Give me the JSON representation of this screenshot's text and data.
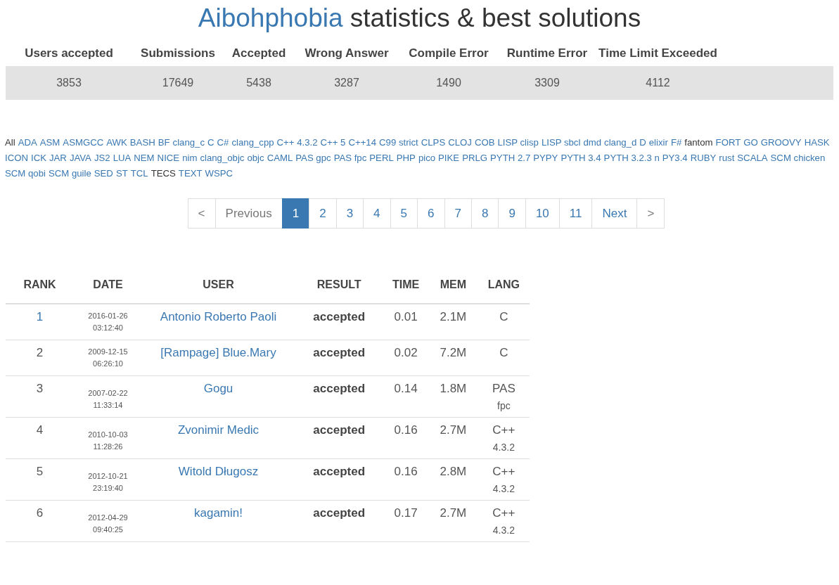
{
  "title": {
    "problem": "Aibohphobia",
    "rest": "statistics & best solutions"
  },
  "stats": {
    "columns": [
      "Users accepted",
      "Submissions",
      "Accepted",
      "Wrong Answer",
      "Compile Error",
      "Runtime Error",
      "Time Limit Exceeded"
    ],
    "values": [
      "3853",
      "17649",
      "5438",
      "3287",
      "1490",
      "3309",
      "4112"
    ]
  },
  "languages": [
    {
      "label": "All",
      "link": false
    },
    {
      "label": "ADA",
      "link": true
    },
    {
      "label": "ASM",
      "link": true
    },
    {
      "label": "ASMGCC",
      "link": true
    },
    {
      "label": "AWK",
      "link": true
    },
    {
      "label": "BASH",
      "link": true
    },
    {
      "label": "BF",
      "link": true
    },
    {
      "label": "clang_c",
      "link": true
    },
    {
      "label": "C",
      "link": true
    },
    {
      "label": "C#",
      "link": true
    },
    {
      "label": "clang_cpp",
      "link": true
    },
    {
      "label": "C++ 4.3.2",
      "link": true
    },
    {
      "label": "C++ 5",
      "link": true
    },
    {
      "label": "C++14",
      "link": true
    },
    {
      "label": "C99 strict",
      "link": true
    },
    {
      "label": "CLPS",
      "link": true
    },
    {
      "label": "CLOJ",
      "link": true
    },
    {
      "label": "COB",
      "link": true
    },
    {
      "label": "LISP clisp",
      "link": true
    },
    {
      "label": "LISP sbcl",
      "link": true
    },
    {
      "label": "dmd",
      "link": true
    },
    {
      "label": "clang_d",
      "link": true
    },
    {
      "label": "D",
      "link": true
    },
    {
      "label": "elixir",
      "link": true
    },
    {
      "label": "F#",
      "link": true
    },
    {
      "label": "fantom",
      "link": false
    },
    {
      "label": "FORT",
      "link": true
    },
    {
      "label": "GO",
      "link": true
    },
    {
      "label": "GROOVY",
      "link": true
    },
    {
      "label": "HASK",
      "link": true
    },
    {
      "label": "ICON",
      "link": true
    },
    {
      "label": "ICK",
      "link": true
    },
    {
      "label": "JAR",
      "link": true
    },
    {
      "label": "JAVA",
      "link": true
    },
    {
      "label": "JS2",
      "link": true
    },
    {
      "label": "LUA",
      "link": true
    },
    {
      "label": "NEM",
      "link": true
    },
    {
      "label": "NICE",
      "link": true
    },
    {
      "label": "nim",
      "link": true
    },
    {
      "label": "clang_objc",
      "link": true
    },
    {
      "label": "objc",
      "link": true
    },
    {
      "label": "CAML",
      "link": true
    },
    {
      "label": "PAS gpc",
      "link": true
    },
    {
      "label": "PAS fpc",
      "link": true
    },
    {
      "label": "PERL",
      "link": true
    },
    {
      "label": "PHP",
      "link": true
    },
    {
      "label": "pico",
      "link": true
    },
    {
      "label": "PIKE",
      "link": true
    },
    {
      "label": "PRLG",
      "link": true
    },
    {
      "label": "PYTH 2.7",
      "link": true
    },
    {
      "label": "PYPY",
      "link": true
    },
    {
      "label": "PYTH 3.4",
      "link": true
    },
    {
      "label": "PYTH 3.2.3 n",
      "link": true
    },
    {
      "label": "PY3.4",
      "link": true
    },
    {
      "label": "RUBY",
      "link": true
    },
    {
      "label": "rust",
      "link": true
    },
    {
      "label": "SCALA",
      "link": true
    },
    {
      "label": "SCM chicken",
      "link": true
    },
    {
      "label": "SCM qobi",
      "link": true
    },
    {
      "label": "SCM guile",
      "link": true
    },
    {
      "label": "SED",
      "link": true
    },
    {
      "label": "ST",
      "link": true
    },
    {
      "label": "TCL",
      "link": true
    },
    {
      "label": "TECS",
      "link": false
    },
    {
      "label": "TEXT",
      "link": true
    },
    {
      "label": "WSPC",
      "link": true
    }
  ],
  "pagination": [
    {
      "label": "<",
      "selected": false
    },
    {
      "label": "Previous",
      "selected": false
    },
    {
      "label": "1",
      "selected": true
    },
    {
      "label": "2",
      "selected": false
    },
    {
      "label": "3",
      "selected": false
    },
    {
      "label": "4",
      "selected": false
    },
    {
      "label": "5",
      "selected": false
    },
    {
      "label": "6",
      "selected": false
    },
    {
      "label": "7",
      "selected": false
    },
    {
      "label": "8",
      "selected": false
    },
    {
      "label": "9",
      "selected": false
    },
    {
      "label": "10",
      "selected": false
    },
    {
      "label": "11",
      "selected": false
    },
    {
      "label": "Next",
      "selected": false
    },
    {
      "label": ">",
      "selected": false
    }
  ],
  "table": {
    "columns": [
      "RANK",
      "DATE",
      "USER",
      "RESULT",
      "TIME",
      "MEM",
      "LANG"
    ],
    "rows": [
      {
        "rank": "1",
        "rank_link": true,
        "date": "2016-01-26",
        "time_of_day": "03:12:40",
        "user": "Antonio Roberto Paoli",
        "result": "accepted",
        "time": "0.01",
        "mem": "2.1M",
        "lang": [
          "C"
        ]
      },
      {
        "rank": "2",
        "rank_link": false,
        "date": "2009-12-15",
        "time_of_day": "06:26:10",
        "user": "[Rampage] Blue.Mary",
        "result": "accepted",
        "time": "0.02",
        "mem": "7.2M",
        "lang": [
          "C"
        ]
      },
      {
        "rank": "3",
        "rank_link": false,
        "date": "2007-02-22",
        "time_of_day": "11:33:14",
        "user": "Gogu",
        "result": "accepted",
        "time": "0.14",
        "mem": "1.8M",
        "lang": [
          "PAS",
          "fpc"
        ]
      },
      {
        "rank": "4",
        "rank_link": false,
        "date": "2010-10-03",
        "time_of_day": "11:28:26",
        "user": "Zvonimir Medic",
        "result": "accepted",
        "time": "0.16",
        "mem": "2.7M",
        "lang": [
          "C++",
          "4.3.2"
        ]
      },
      {
        "rank": "5",
        "rank_link": false,
        "date": "2012-10-21",
        "time_of_day": "23:19:40",
        "user": "Witold Długosz",
        "result": "accepted",
        "time": "0.16",
        "mem": "2.8M",
        "lang": [
          "C++",
          "4.3.2"
        ]
      },
      {
        "rank": "6",
        "rank_link": false,
        "date": "2012-04-29",
        "time_of_day": "09:40:25",
        "user": "kagamin!",
        "result": "accepted",
        "time": "0.17",
        "mem": "2.7M",
        "lang": [
          "C++",
          "4.3.2"
        ]
      }
    ]
  }
}
